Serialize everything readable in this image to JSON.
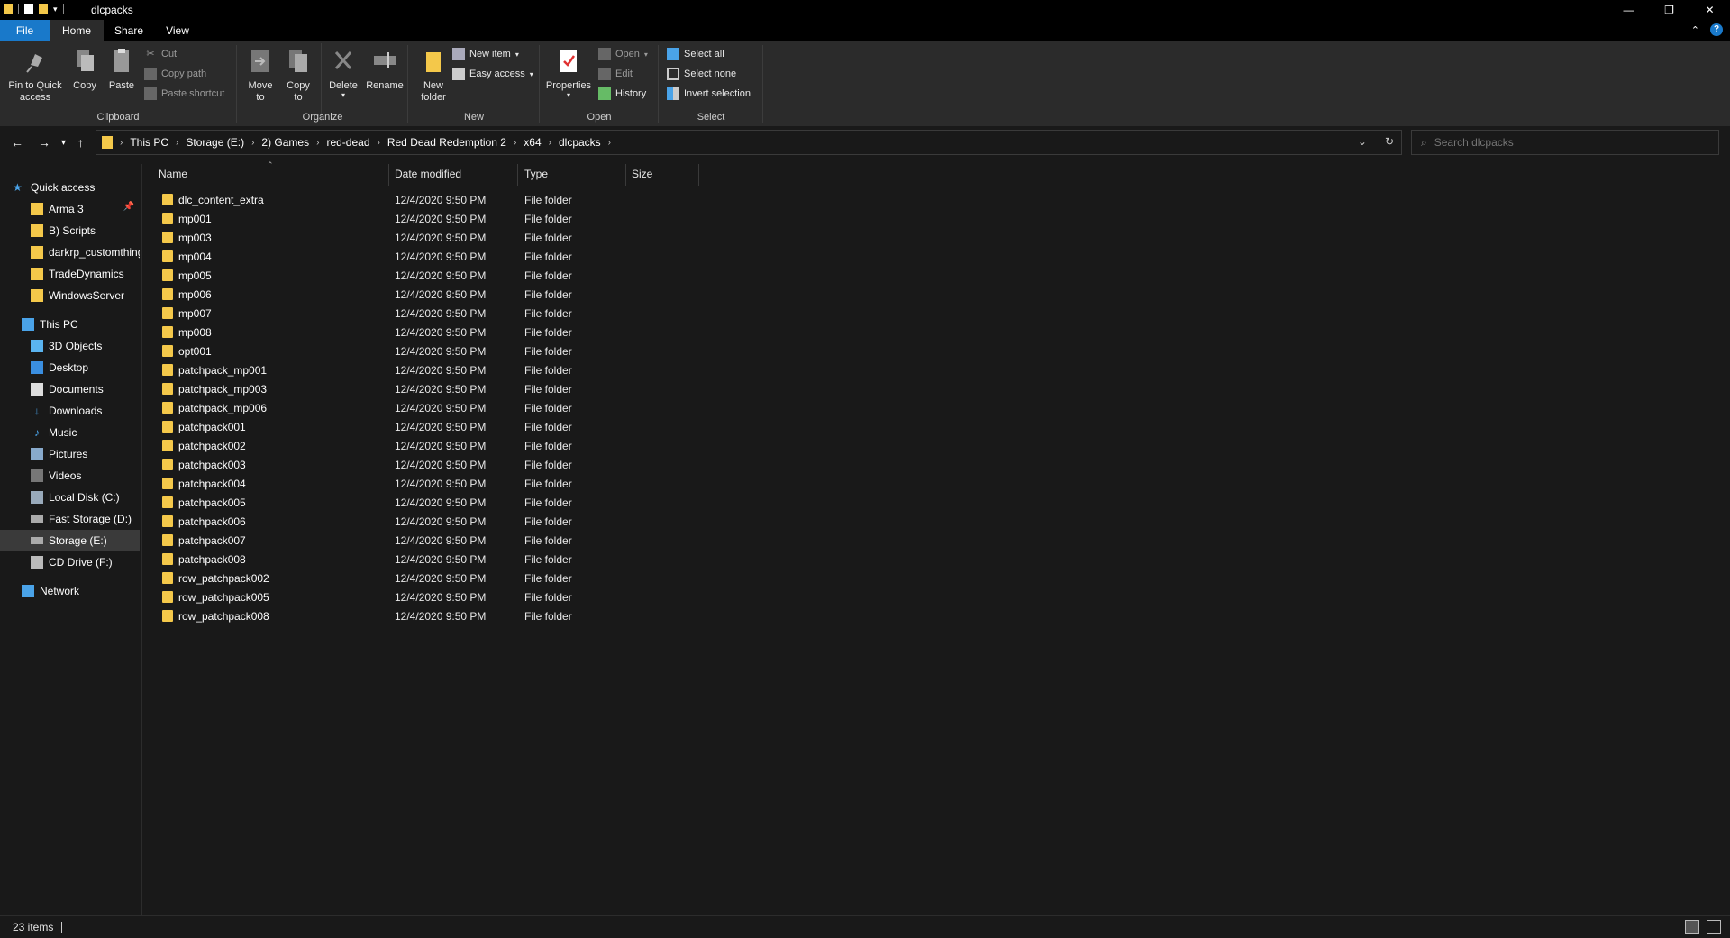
{
  "window": {
    "title": "dlcpacks",
    "minimize": "—",
    "restore": "❐",
    "close": "✕"
  },
  "ribbon_tabs": [
    "File",
    "Home",
    "Share",
    "View"
  ],
  "ribbon": {
    "clipboard": {
      "label": "Clipboard",
      "pin": "Pin to Quick access",
      "copy": "Copy",
      "paste": "Paste",
      "cut": "Cut",
      "copy_path": "Copy path",
      "paste_shortcut": "Paste shortcut"
    },
    "organize": {
      "label": "Organize",
      "move_to": "Move to",
      "copy_to": "Copy to",
      "delete": "Delete",
      "rename": "Rename"
    },
    "new": {
      "label": "New",
      "new_folder": "New folder",
      "new_item": "New item",
      "easy_access": "Easy access"
    },
    "open": {
      "label": "Open",
      "properties": "Properties",
      "open": "Open",
      "edit": "Edit",
      "history": "History"
    },
    "select": {
      "label": "Select",
      "select_all": "Select all",
      "select_none": "Select none",
      "invert_selection": "Invert selection"
    }
  },
  "address": {
    "crumbs": [
      "This PC",
      "Storage (E:)",
      "2) Games",
      "red-dead",
      "Red Dead Redemption 2",
      "x64",
      "dlcpacks"
    ],
    "search_placeholder": "Search dlcpacks"
  },
  "nav": {
    "quick_access": "Quick access",
    "quick_items": [
      "Arma 3",
      "B) Scripts",
      "darkrp_customthings",
      "TradeDynamics",
      "WindowsServer"
    ],
    "this_pc": "This PC",
    "pc_items": [
      "3D Objects",
      "Desktop",
      "Documents",
      "Downloads",
      "Music",
      "Pictures",
      "Videos",
      "Local Disk (C:)",
      "Fast Storage (D:)",
      "Storage (E:)",
      "CD Drive (F:)"
    ],
    "network": "Network"
  },
  "columns": {
    "name": "Name",
    "date": "Date modified",
    "type": "Type",
    "size": "Size"
  },
  "files": [
    {
      "name": "dlc_content_extra",
      "date": "12/4/2020 9:50 PM",
      "type": "File folder"
    },
    {
      "name": "mp001",
      "date": "12/4/2020 9:50 PM",
      "type": "File folder"
    },
    {
      "name": "mp003",
      "date": "12/4/2020 9:50 PM",
      "type": "File folder"
    },
    {
      "name": "mp004",
      "date": "12/4/2020 9:50 PM",
      "type": "File folder"
    },
    {
      "name": "mp005",
      "date": "12/4/2020 9:50 PM",
      "type": "File folder"
    },
    {
      "name": "mp006",
      "date": "12/4/2020 9:50 PM",
      "type": "File folder"
    },
    {
      "name": "mp007",
      "date": "12/4/2020 9:50 PM",
      "type": "File folder"
    },
    {
      "name": "mp008",
      "date": "12/4/2020 9:50 PM",
      "type": "File folder"
    },
    {
      "name": "opt001",
      "date": "12/4/2020 9:50 PM",
      "type": "File folder"
    },
    {
      "name": "patchpack_mp001",
      "date": "12/4/2020 9:50 PM",
      "type": "File folder"
    },
    {
      "name": "patchpack_mp003",
      "date": "12/4/2020 9:50 PM",
      "type": "File folder"
    },
    {
      "name": "patchpack_mp006",
      "date": "12/4/2020 9:50 PM",
      "type": "File folder"
    },
    {
      "name": "patchpack001",
      "date": "12/4/2020 9:50 PM",
      "type": "File folder"
    },
    {
      "name": "patchpack002",
      "date": "12/4/2020 9:50 PM",
      "type": "File folder"
    },
    {
      "name": "patchpack003",
      "date": "12/4/2020 9:50 PM",
      "type": "File folder"
    },
    {
      "name": "patchpack004",
      "date": "12/4/2020 9:50 PM",
      "type": "File folder"
    },
    {
      "name": "patchpack005",
      "date": "12/4/2020 9:50 PM",
      "type": "File folder"
    },
    {
      "name": "patchpack006",
      "date": "12/4/2020 9:50 PM",
      "type": "File folder"
    },
    {
      "name": "patchpack007",
      "date": "12/4/2020 9:50 PM",
      "type": "File folder"
    },
    {
      "name": "patchpack008",
      "date": "12/4/2020 9:50 PM",
      "type": "File folder"
    },
    {
      "name": "row_patchpack002",
      "date": "12/4/2020 9:50 PM",
      "type": "File folder"
    },
    {
      "name": "row_patchpack005",
      "date": "12/4/2020 9:50 PM",
      "type": "File folder"
    },
    {
      "name": "row_patchpack008",
      "date": "12/4/2020 9:50 PM",
      "type": "File folder"
    }
  ],
  "status": {
    "items": "23 items"
  },
  "colors": {
    "accent": "#1979ca",
    "folder": "#f4c84a",
    "background": "#191919",
    "ribbon": "#2b2b2b"
  }
}
